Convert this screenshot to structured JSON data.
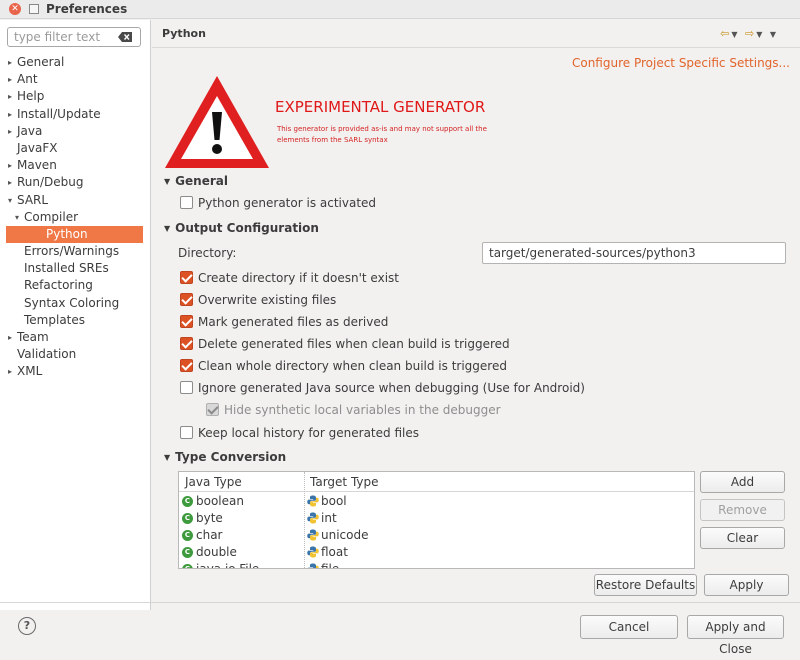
{
  "window": {
    "title": "Preferences"
  },
  "filter": {
    "placeholder": "type filter text"
  },
  "tree": [
    {
      "label": "General",
      "arrow": "▸",
      "indent": 1,
      "selected": false
    },
    {
      "label": "Ant",
      "arrow": "▸",
      "indent": 1,
      "selected": false
    },
    {
      "label": "Help",
      "arrow": "▸",
      "indent": 1,
      "selected": false
    },
    {
      "label": "Install/Update",
      "arrow": "▸",
      "indent": 1,
      "selected": false
    },
    {
      "label": "Java",
      "arrow": "▸",
      "indent": 1,
      "selected": false
    },
    {
      "label": "JavaFX",
      "arrow": "",
      "indent": 1,
      "selected": false
    },
    {
      "label": "Maven",
      "arrow": "▸",
      "indent": 1,
      "selected": false
    },
    {
      "label": "Run/Debug",
      "arrow": "▸",
      "indent": 1,
      "selected": false
    },
    {
      "label": "SARL",
      "arrow": "▾",
      "indent": 1,
      "selected": false
    },
    {
      "label": "Compiler",
      "arrow": "▾",
      "indent": 2,
      "selected": false
    },
    {
      "label": "Python",
      "arrow": "",
      "indent": 3,
      "selected": true
    },
    {
      "label": "Errors/Warnings",
      "arrow": "",
      "indent": 2,
      "selected": false
    },
    {
      "label": "Installed SREs",
      "arrow": "",
      "indent": 2,
      "selected": false
    },
    {
      "label": "Refactoring",
      "arrow": "",
      "indent": 2,
      "selected": false
    },
    {
      "label": "Syntax Coloring",
      "arrow": "",
      "indent": 2,
      "selected": false
    },
    {
      "label": "Templates",
      "arrow": "",
      "indent": 2,
      "selected": false
    },
    {
      "label": "Team",
      "arrow": "▸",
      "indent": 1,
      "selected": false
    },
    {
      "label": "Validation",
      "arrow": "",
      "indent": 1,
      "selected": false
    },
    {
      "label": "XML",
      "arrow": "▸",
      "indent": 1,
      "selected": false
    }
  ],
  "panel": {
    "title": "Python",
    "configure_link": "Configure Project Specific Settings...",
    "experimental_title": "EXPERIMENTAL GENERATOR",
    "experimental_desc": "This generator is provided as-is and may not support all the elements from the SARL syntax"
  },
  "general": {
    "title": "General",
    "activated": {
      "label": "Python generator is activated",
      "checked": false
    }
  },
  "output": {
    "title": "Output Configuration",
    "directory_label": "Directory:",
    "directory_value": "target/generated-sources/python3",
    "options": [
      {
        "label": "Create directory if it doesn't exist",
        "checked": true,
        "disabled": false
      },
      {
        "label": "Overwrite existing files",
        "checked": true,
        "disabled": false
      },
      {
        "label": "Mark generated files as derived",
        "checked": true,
        "disabled": false
      },
      {
        "label": "Delete generated files when clean build is triggered",
        "checked": true,
        "disabled": false
      },
      {
        "label": "Clean whole directory when clean build is triggered",
        "checked": true,
        "disabled": false
      },
      {
        "label": "Ignore generated Java source when debugging (Use for Android)",
        "checked": false,
        "disabled": false
      },
      {
        "label": "Hide synthetic local variables in the debugger",
        "checked": true,
        "disabled": true
      },
      {
        "label": "Keep local history for generated files",
        "checked": false,
        "disabled": false
      }
    ]
  },
  "types": {
    "title": "Type Conversion",
    "columns": {
      "java": "Java Type",
      "target": "Target Type"
    },
    "rows": [
      {
        "java": "boolean",
        "target": "bool"
      },
      {
        "java": "byte",
        "target": "int"
      },
      {
        "java": "char",
        "target": "unicode"
      },
      {
        "java": "double",
        "target": "float"
      },
      {
        "java": "java.io.File",
        "target": "file"
      }
    ],
    "buttons": {
      "add": "Add",
      "remove": "Remove",
      "clear": "Clear"
    }
  },
  "actions": {
    "restore_defaults": "Restore Defaults",
    "apply": "Apply",
    "cancel": "Cancel",
    "apply_close": "Apply and Close"
  },
  "colors": {
    "accent": "#f07746",
    "checkbox": "#dd5225",
    "link": "#e2642b",
    "warning": "#e01818"
  }
}
